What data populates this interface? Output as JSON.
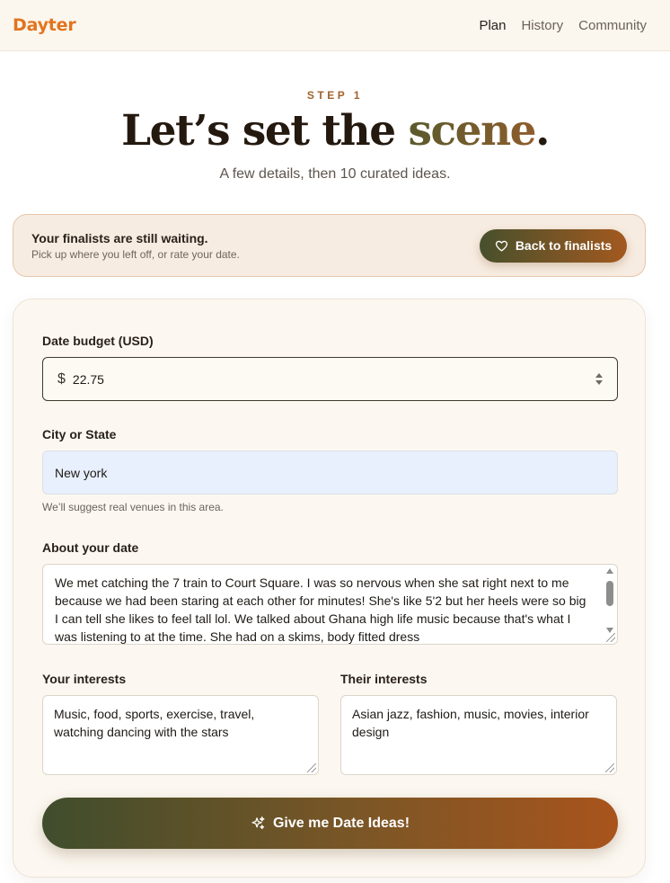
{
  "header": {
    "brand": "Dayter",
    "nav": [
      {
        "label": "Plan",
        "active": true
      },
      {
        "label": "History",
        "active": false
      },
      {
        "label": "Community",
        "active": false
      }
    ]
  },
  "hero": {
    "step": "STEP 1",
    "title_main": "Let’s set the ",
    "title_accent": "scene",
    "title_end": ".",
    "subtitle": "A few details, then 10 curated ideas."
  },
  "banner": {
    "title": "Your finalists are still waiting.",
    "subtitle": "Pick up where you left off, or rate your date.",
    "button_label": "Back to finalists",
    "button_icon": "heart-icon"
  },
  "form": {
    "budget_label": "Date budget (USD)",
    "budget_currency": "$",
    "budget_value": "22.75",
    "city_label": "City or State",
    "city_value": "New york",
    "city_hint": "We’ll suggest real venues in this area.",
    "about_label": "About your date",
    "about_value": "We met catching the 7 train to Court Square. I was so nervous when she sat right next to me because we had been staring at each other for minutes! She's like 5'2 but her heels were so big I can tell she likes to feel tall lol. We talked about Ghana high life music because that's what I was listening to at the time. She had on a skims, body fitted dress",
    "your_interests_label": "Your interests",
    "your_interests_value": "Music, food, sports, exercise, travel, watching dancing with the stars",
    "their_interests_label": "Their interests",
    "their_interests_value": "Asian jazz, fashion, music, movies, interior design",
    "submit_label": "Give me Date Ideas!",
    "submit_icon": "sparkles-icon"
  },
  "colors": {
    "brand": "#e2741e",
    "accent_start": "#47502c",
    "accent_end": "#a3591f",
    "page_bg": "#fcf8f1"
  }
}
